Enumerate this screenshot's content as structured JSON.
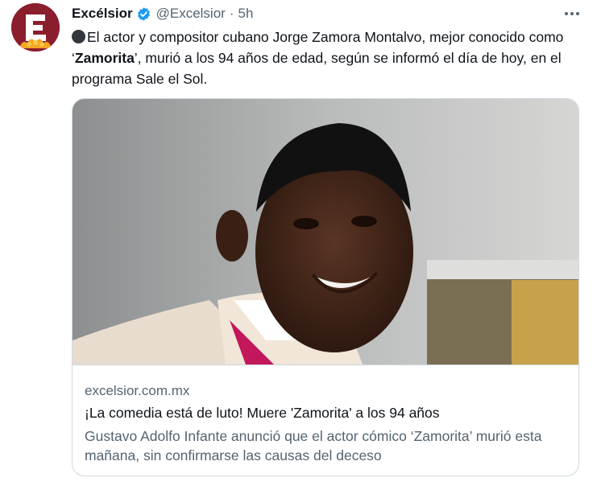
{
  "tweet": {
    "author_name": "Excélsior",
    "handle": "@Excelsior",
    "separator": "·",
    "time": "5h",
    "text_part1": "El actor y compositor cubano Jorge Zamora Montalvo, mejor conocido como ‘",
    "text_bold": "Zamorita",
    "text_part2": "’, murió a los 94 años de edad, según se informó el día de hoy, en el programa Sale el Sol.",
    "card": {
      "domain": "excelsior.com.mx",
      "title": "¡La comedia está de luto! Muere 'Zamorita' a los 94 años",
      "description": "Gustavo Adolfo Infante anunció que el actor cómico ‘Zamorita’ murió esta mañana, sin confirmarse las causas del deceso"
    }
  },
  "colors": {
    "brand": "#8b1e2d",
    "verified": "#1d9bf0",
    "secondary_text": "#536471",
    "border": "#cfd9de"
  },
  "icons": [
    "excelsior-logo",
    "verified-badge-icon",
    "more-options-icon",
    "black-circle-emoji"
  ]
}
